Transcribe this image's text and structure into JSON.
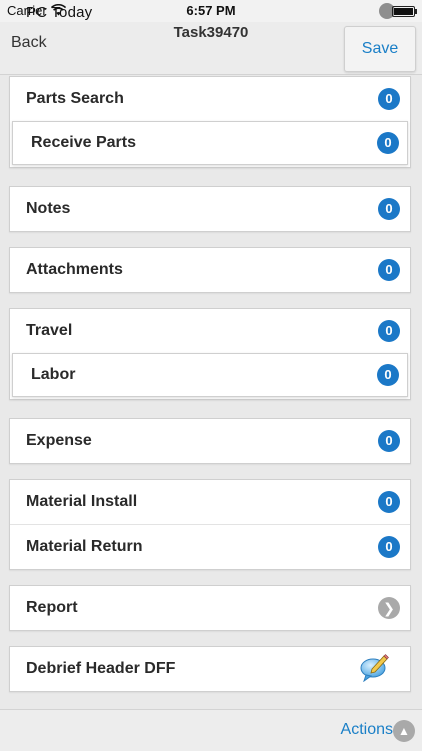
{
  "status_bar": {
    "carrier": "Carrier",
    "overlay_text": "PC Today",
    "time": "6:57 PM",
    "wifi_icon": "wifi-icon",
    "battery_icon": "battery-icon"
  },
  "nav": {
    "back_label": "Back",
    "title": "Task39470",
    "save_label": "Save"
  },
  "sections": {
    "parts": {
      "parts_search": {
        "label": "Parts Search",
        "count": "0"
      },
      "receive_parts": {
        "label": "Receive Parts",
        "count": "0"
      }
    },
    "notes": {
      "label": "Notes",
      "count": "0"
    },
    "attachments": {
      "label": "Attachments",
      "count": "0"
    },
    "travel_labor": {
      "travel": {
        "label": "Travel",
        "count": "0"
      },
      "labor": {
        "label": "Labor",
        "count": "0"
      }
    },
    "expense": {
      "label": "Expense",
      "count": "0"
    },
    "material": {
      "install": {
        "label": "Material Install",
        "count": "0"
      },
      "return": {
        "label": "Material Return",
        "count": "0"
      }
    },
    "report": {
      "label": "Report",
      "icon": "chevron-right-icon"
    },
    "dff": {
      "label": "Debrief Header DFF",
      "icon": "edit-comment-icon"
    }
  },
  "bottom_bar": {
    "actions_label": "Actions",
    "actions_icon": "chevron-up-icon"
  },
  "colors": {
    "accent": "#1a7fc7",
    "badge": "#1b78c7",
    "background": "#e9e9e9"
  }
}
